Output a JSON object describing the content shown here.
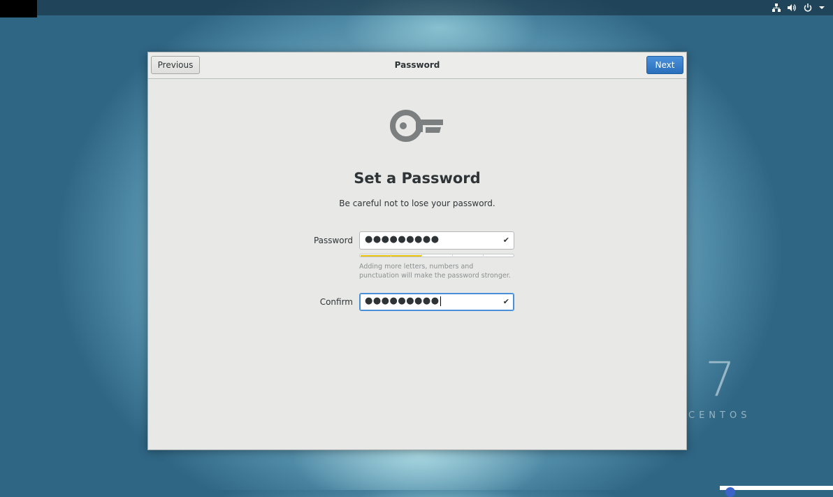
{
  "dialog": {
    "previous_label": "Previous",
    "title": "Password",
    "next_label": "Next"
  },
  "content": {
    "heading": "Set a Password",
    "subheading": "Be careful not to lose your password.",
    "password_label": "Password",
    "password_value": "●●●●●●●●●",
    "strength_level": 0.4,
    "hint": "Adding more letters, numbers and punctuation will make the password stronger.",
    "confirm_label": "Confirm",
    "confirm_value": "●●●●●●●●●"
  },
  "branding": {
    "version": "7",
    "name": "CENTOS"
  },
  "icons": {
    "tray": [
      "network-icon",
      "volume-icon",
      "power-icon",
      "chevron-down-icon"
    ],
    "main": "key-icon",
    "field_status": "checkmark-icon"
  },
  "colors": {
    "accent": "#4a90d9",
    "strength_bar": "#e8c20b"
  }
}
